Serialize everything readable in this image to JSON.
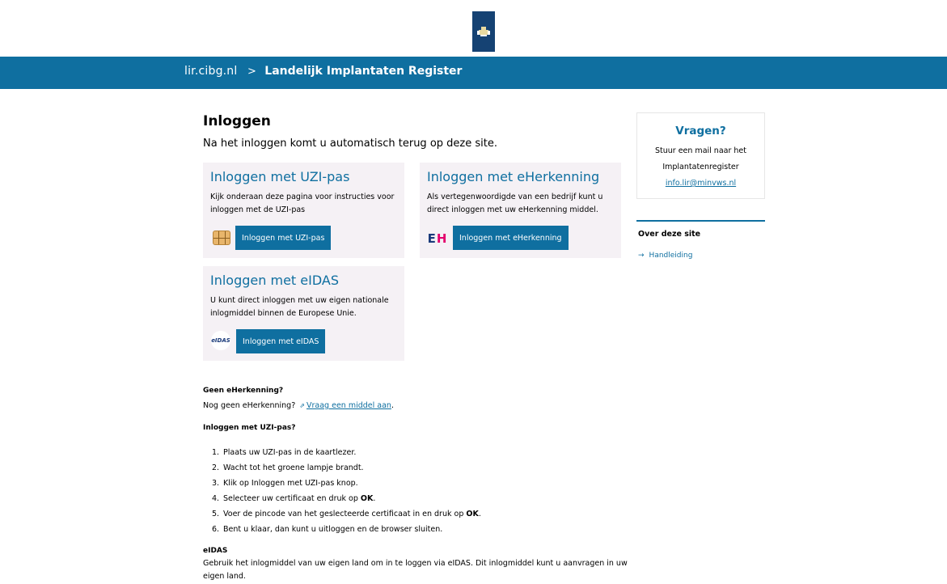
{
  "header": {
    "site": "lir.cibg.nl",
    "separator": ">",
    "title": "Landelijk Implantaten Register"
  },
  "main": {
    "title": "Inloggen",
    "subtitle": "Na het inloggen komt u automatisch terug op deze site.",
    "cards": {
      "uzi": {
        "heading": "Inloggen met UZI-pas",
        "text_line1": "Kijk onderaan deze pagina voor instructies voor",
        "text_line2": "inloggen met de UZI-pas",
        "button": "Inloggen met UZI-pas",
        "icon": "smartcard-chip-icon"
      },
      "eherkenning": {
        "heading": "Inloggen met eHerkenning",
        "text_line1": "Als vertegenwoordigde van een bedrijf kunt u",
        "text_line2": "direct inloggen met uw eHerkenning middel.",
        "button": "Inloggen met eHerkenning",
        "icon_text_e": "E",
        "icon_text_h": "H"
      },
      "eidas": {
        "heading": "Inloggen met eIDAS",
        "text_line1": "U kunt direct inloggen met uw eigen nationale",
        "text_line2": "inlogmiddel binnen de Europese Unie.",
        "button": "Inloggen met eIDAS",
        "icon_text": "eIDAS"
      }
    },
    "no_eherkenning": {
      "heading": "Geen eHerkenning?",
      "text": "Nog geen eHerkenning?",
      "link": "Vraag een middel aan",
      "after": "."
    },
    "uzi_help": {
      "heading": "Inloggen met UZI-pas?",
      "steps": [
        {
          "num": "1.",
          "text": "Plaats uw UZI-pas in de kaartlezer."
        },
        {
          "num": "2.",
          "text": "Wacht tot het groene lampje brandt."
        },
        {
          "num": "3.",
          "text": "Klik op Inloggen met UZI-pas knop."
        },
        {
          "num": "4.",
          "text": "Selecteer uw certificaat en druk op ",
          "bold": "OK",
          "after": "."
        },
        {
          "num": "5.",
          "text": "Voer de pincode van het geslecteerde certificaat in en druk op ",
          "bold": "OK",
          "after": "."
        },
        {
          "num": "6.",
          "text": "Bent u klaar, dan kunt u uitloggen en de browser sluiten."
        }
      ]
    },
    "eidas_help": {
      "heading": "eIDAS",
      "line1": "Gebruik het inlogmiddel van uw eigen land om in te loggen via eIDAS. Dit inlogmiddel kunt u aanvragen in uw",
      "line2": "eigen land."
    }
  },
  "aside": {
    "questions": {
      "heading": "Vragen?",
      "line1": "Stuur een mail naar het",
      "line2": "Implantatenregister",
      "email": "info.lir@minvws.nl"
    },
    "about": {
      "heading": "Over deze site",
      "link_arrow": "→",
      "link": "Handleiding"
    }
  },
  "colors": {
    "primary": "#0f6fa0",
    "logo_bg": "#154273",
    "card_bg": "#f5f1f5"
  }
}
